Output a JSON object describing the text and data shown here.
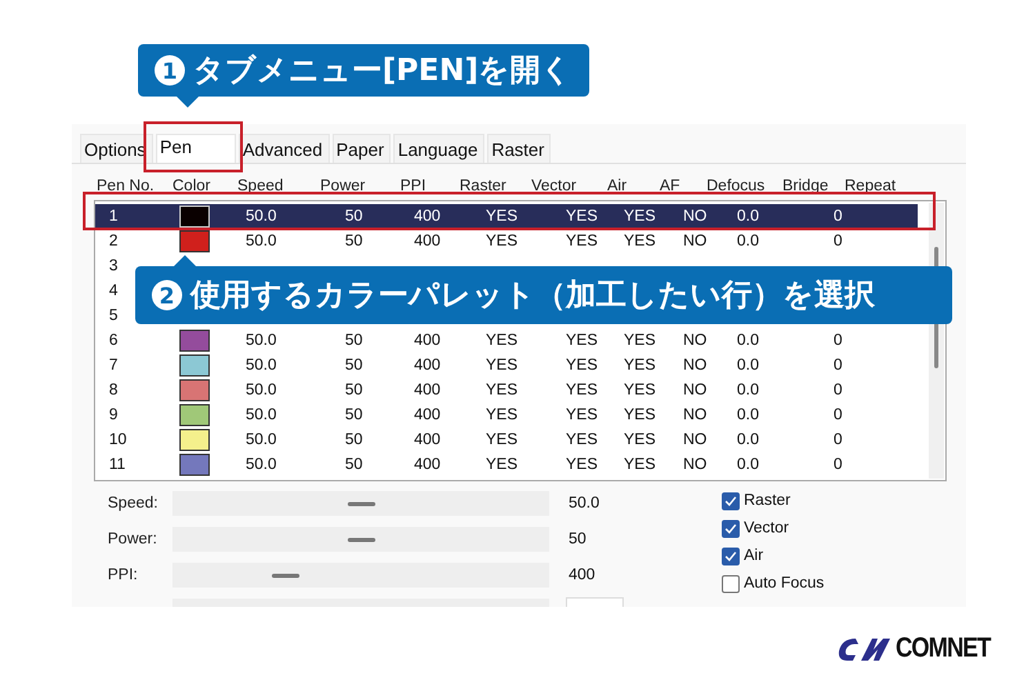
{
  "callouts": [
    {
      "number": "1",
      "text": "タブメニュー[PEN]を開く"
    },
    {
      "number": "2",
      "text": "使用するカラーパレット（加工したい行）を選択"
    }
  ],
  "tabs": [
    {
      "label": "Options",
      "selected": false
    },
    {
      "label": "Pen",
      "selected": true
    },
    {
      "label": "Advanced",
      "selected": false
    },
    {
      "label": "Paper",
      "selected": false
    },
    {
      "label": "Language",
      "selected": false
    },
    {
      "label": "Raster",
      "selected": false
    }
  ],
  "table": {
    "columns": [
      "Pen No.",
      "Color",
      "Speed",
      "Power",
      "PPI",
      "Raster",
      "Vector",
      "Air",
      "AF",
      "Defocus",
      "Bridge",
      "Repeat"
    ],
    "rows": [
      {
        "pen_no": "1",
        "color": "#0a0000",
        "speed": "50.0",
        "power": "50",
        "ppi": "400",
        "raster": "YES",
        "vector": "YES",
        "air": "YES",
        "af": "NO",
        "defocus": "0.0",
        "repeat": "0",
        "selected": true
      },
      {
        "pen_no": "2",
        "color": "#d0201c",
        "speed": "50.0",
        "power": "50",
        "ppi": "400",
        "raster": "YES",
        "vector": "YES",
        "air": "YES",
        "af": "NO",
        "defocus": "0.0",
        "repeat": "0",
        "selected": false
      },
      {
        "pen_no": "3",
        "selected": false
      },
      {
        "pen_no": "4",
        "selected": false
      },
      {
        "pen_no": "5",
        "selected": false
      },
      {
        "pen_no": "6",
        "color": "#944c9c",
        "speed": "50.0",
        "power": "50",
        "ppi": "400",
        "raster": "YES",
        "vector": "YES",
        "air": "YES",
        "af": "NO",
        "defocus": "0.0",
        "repeat": "0",
        "selected": false
      },
      {
        "pen_no": "7",
        "color": "#8cc8d4",
        "speed": "50.0",
        "power": "50",
        "ppi": "400",
        "raster": "YES",
        "vector": "YES",
        "air": "YES",
        "af": "NO",
        "defocus": "0.0",
        "repeat": "0",
        "selected": false
      },
      {
        "pen_no": "8",
        "color": "#d87474",
        "speed": "50.0",
        "power": "50",
        "ppi": "400",
        "raster": "YES",
        "vector": "YES",
        "air": "YES",
        "af": "NO",
        "defocus": "0.0",
        "repeat": "0",
        "selected": false
      },
      {
        "pen_no": "9",
        "color": "#a0c878",
        "speed": "50.0",
        "power": "50",
        "ppi": "400",
        "raster": "YES",
        "vector": "YES",
        "air": "YES",
        "af": "NO",
        "defocus": "0.0",
        "repeat": "0",
        "selected": false
      },
      {
        "pen_no": "10",
        "color": "#f4f08c",
        "speed": "50.0",
        "power": "50",
        "ppi": "400",
        "raster": "YES",
        "vector": "YES",
        "air": "YES",
        "af": "NO",
        "defocus": "0.0",
        "repeat": "0",
        "selected": false
      },
      {
        "pen_no": "11",
        "color": "#7478bc",
        "speed": "50.0",
        "power": "50",
        "ppi": "400",
        "raster": "YES",
        "vector": "YES",
        "air": "YES",
        "af": "NO",
        "defocus": "0.0",
        "repeat": "0",
        "selected": false
      }
    ]
  },
  "sliders": [
    {
      "label": "Speed:",
      "level": 0.5,
      "reading": "50.0"
    },
    {
      "label": "Power:",
      "level": 0.5,
      "reading": "50"
    },
    {
      "label": "PPI:",
      "level": 0.3,
      "reading": "400"
    }
  ],
  "checkboxes": [
    {
      "label": "Raster",
      "checked": true
    },
    {
      "label": "Vector",
      "checked": true
    },
    {
      "label": "Air",
      "checked": true
    },
    {
      "label": "Auto Focus",
      "checked": false
    }
  ],
  "logo": {
    "text": "COMNET"
  }
}
